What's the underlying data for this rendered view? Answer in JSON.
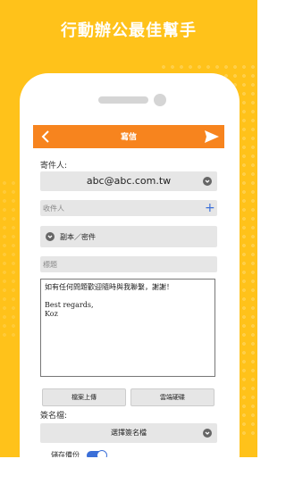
{
  "headline": "行動辦公最佳幫手",
  "app": {
    "title": "寫信",
    "sender_label": "寄件人:",
    "sender_value": "abc@abc.com.tw",
    "recipient_placeholder": "收件人",
    "cc_label": "副本／密件",
    "subject_placeholder": "標題",
    "body_line1": "如有任何問題歡迎隨時與我聯繫，謝謝！",
    "body_line2": "Best regards,",
    "body_line3": "Koz",
    "upload_button": "檔案上傳",
    "cloud_button": "雲端硬碟",
    "signature_label": "簽名檔:",
    "signature_select": "選擇簽名檔",
    "save_backup_label": "儲存備份"
  },
  "colors": {
    "background": "#FFC21A",
    "toolbar": "#F7841E",
    "accent": "#3b6fd8"
  },
  "icons": [
    "back-arrow-icon",
    "send-icon",
    "chevron-down-icon",
    "plus-icon"
  ]
}
